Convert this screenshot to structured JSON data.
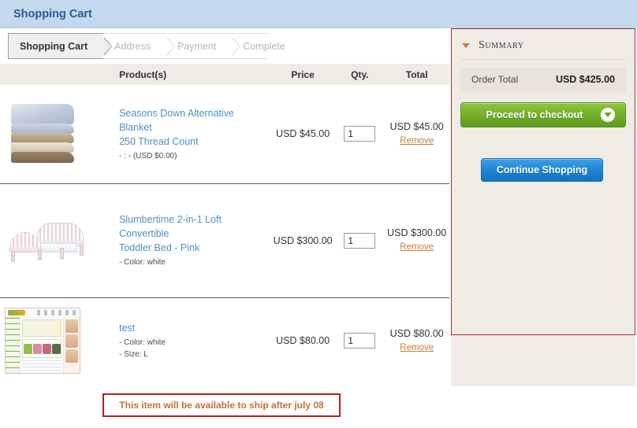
{
  "header": {
    "title": "Shopping Cart"
  },
  "steps": [
    {
      "label": "Shopping Cart",
      "state": "active"
    },
    {
      "label": "Address",
      "state": "inactive"
    },
    {
      "label": "Payment",
      "state": "inactive"
    },
    {
      "label": "Complete",
      "state": "inactive"
    }
  ],
  "table": {
    "columns": {
      "image": "",
      "product": "Product(s)",
      "price": "Price",
      "qty": "Qty.",
      "total": "Total"
    },
    "rows": [
      {
        "image_name": "blanket-stack-image",
        "name_line1": "Seasons Down Alternative Blanket",
        "name_line2": "250 Thread Count",
        "options": [
          "- : - (USD $0.00)"
        ],
        "price": "USD $45.00",
        "qty": "1",
        "total": "USD $45.00",
        "remove_label": "Remove"
      },
      {
        "image_name": "toddler-bed-image",
        "name_line1": "Slumbertime 2-in-1 Loft Convertible",
        "name_line2": "Toddler Bed - Pink",
        "options": [
          "- Color: white"
        ],
        "price": "USD $300.00",
        "qty": "1",
        "total": "USD $300.00",
        "remove_label": "Remove"
      },
      {
        "image_name": "website-screenshot-image",
        "name_line1": "test",
        "name_line2": "",
        "options": [
          "- Color: white",
          "- Size: L"
        ],
        "price": "USD $80.00",
        "qty": "1",
        "total": "USD $80.00",
        "remove_label": "Remove"
      }
    ]
  },
  "notice": {
    "text": "This item will be available to ship after july 08"
  },
  "summary": {
    "heading": "Summary",
    "order_total_label": "Order Total",
    "order_total_value": "USD $425.00",
    "checkout_label": "Proceed to checkout",
    "continue_label": "Continue Shopping"
  },
  "colors": {
    "header_bar": "#c5d9ee",
    "header_text": "#2a5a96",
    "panel_bg": "#efece6",
    "link": "#4f8fc0",
    "remove_link": "#c77f3b",
    "checkout_green": "#76b02c",
    "continue_blue": "#1e86d4",
    "notice_border": "#b02020",
    "notice_text": "#c1703f",
    "highlight_border": "#a33030"
  }
}
